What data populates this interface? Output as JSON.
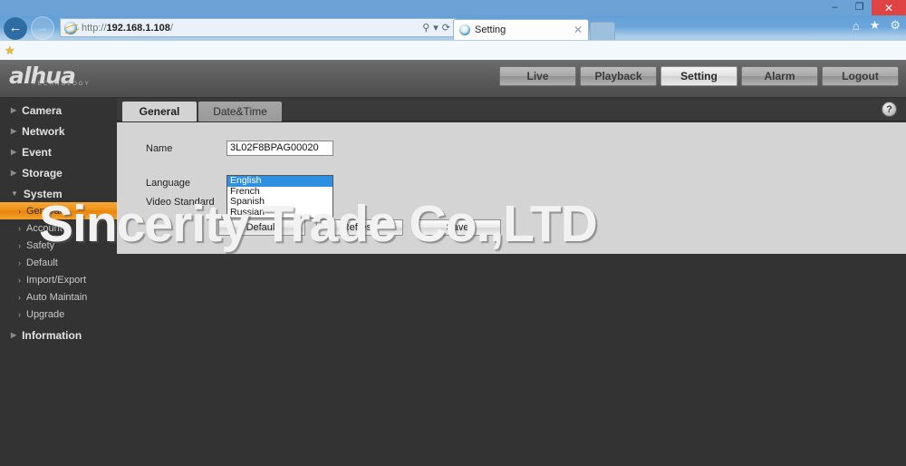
{
  "browser": {
    "url_scheme": "http://",
    "url_host": "192.168.1.108",
    "url_path": "/",
    "back_icon": "←",
    "forward_icon": "→",
    "search_icon": "⚲",
    "dropdown_icon": "▾",
    "refresh_icon": "⟳",
    "tab_title": "Setting",
    "tab_close": "✕",
    "home_icon": "⌂",
    "favorites_icon": "★",
    "tools_icon": "⚙",
    "minimize_icon": "–",
    "restore_icon": "❐",
    "close_icon": "✕",
    "bookmark_star": "★"
  },
  "header": {
    "brand": "alhua",
    "brand_sub": "TECHNOLOGY",
    "nav": [
      {
        "label": "Live",
        "active": false
      },
      {
        "label": "Playback",
        "active": false
      },
      {
        "label": "Setting",
        "active": true
      },
      {
        "label": "Alarm",
        "active": false
      },
      {
        "label": "Logout",
        "active": false
      }
    ]
  },
  "sidebar": {
    "collapsed_caret": "▶",
    "expanded_caret": "▼",
    "sub_caret": "›",
    "groups": [
      {
        "label": "Camera",
        "expanded": false
      },
      {
        "label": "Network",
        "expanded": false
      },
      {
        "label": "Event",
        "expanded": false
      },
      {
        "label": "Storage",
        "expanded": false
      },
      {
        "label": "System",
        "expanded": true
      }
    ],
    "system_items": [
      {
        "label": "General",
        "active": true
      },
      {
        "label": "Account",
        "active": false
      },
      {
        "label": "Safety",
        "active": false
      },
      {
        "label": "Default",
        "active": false
      },
      {
        "label": "Import/Export",
        "active": false
      },
      {
        "label": "Auto Maintain",
        "active": false
      },
      {
        "label": "Upgrade",
        "active": false
      }
    ],
    "information": {
      "label": "Information",
      "expanded": false
    }
  },
  "content": {
    "tabs": [
      {
        "label": "General",
        "selected": true
      },
      {
        "label": "Date&Time",
        "selected": false
      }
    ],
    "help_icon": "?",
    "form": {
      "name_label": "Name",
      "name_value": "3L02F8BPAG00020",
      "language_label": "Language",
      "video_standard_label": "Video Standard",
      "language_options": [
        {
          "label": "English",
          "selected": true
        },
        {
          "label": "French",
          "selected": false
        },
        {
          "label": "Spanish",
          "selected": false
        },
        {
          "label": "Russian",
          "selected": false
        }
      ]
    },
    "buttons": [
      {
        "label": "Default"
      },
      {
        "label": "Refresh"
      },
      {
        "label": "Save"
      }
    ]
  },
  "watermark": {
    "text": "Sincerity Trade Co.,LTD"
  },
  "colors": {
    "accent_orange": "#ef8e14",
    "browser_blue": "#6ca3d6",
    "panel_gray": "#d4d4d4",
    "body_dark": "#333333",
    "select_blue": "#2f8fe0",
    "close_red": "#e04343"
  }
}
